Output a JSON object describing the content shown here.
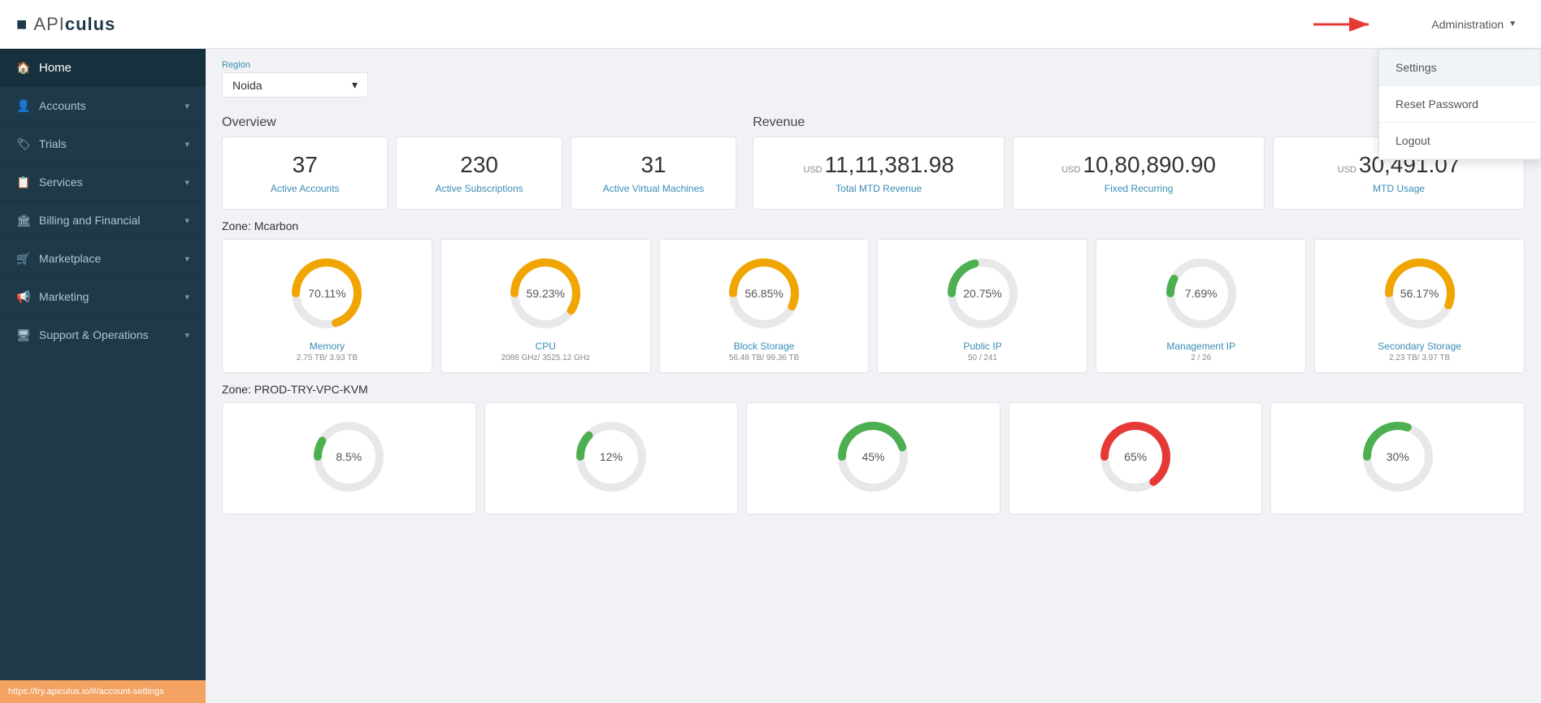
{
  "sidebar": {
    "logo": "APICULUS",
    "home_label": "Home",
    "nav_items": [
      {
        "label": "Accounts",
        "icon": "👤"
      },
      {
        "label": "Trials",
        "icon": "🏷"
      },
      {
        "label": "Services",
        "icon": "📋"
      },
      {
        "label": "Billing and Financial",
        "icon": "🏛"
      },
      {
        "label": "Marketplace",
        "icon": "🛒"
      },
      {
        "label": "Marketing",
        "icon": "📢"
      },
      {
        "label": "Support & Operations",
        "icon": "🖥"
      }
    ],
    "status_url": "https://try.apiculus.io/#/account-settings"
  },
  "header": {
    "admin_label": "Administration",
    "dropdown": {
      "items": [
        {
          "label": "Settings",
          "active": true
        },
        {
          "label": "Reset Password",
          "active": false
        },
        {
          "label": "Logout",
          "active": false
        }
      ]
    }
  },
  "region": {
    "label": "Region",
    "value": "Noida"
  },
  "overview": {
    "title": "Overview",
    "stats": [
      {
        "number": "37",
        "label": "Active Accounts"
      },
      {
        "number": "230",
        "label": "Active Subscriptions"
      },
      {
        "number": "31",
        "label": "Active Virtual Machines"
      }
    ]
  },
  "revenue": {
    "title": "Revenue",
    "stats": [
      {
        "currency": "USD",
        "number": "11,11,381.98",
        "label": "Total MTD Revenue"
      },
      {
        "currency": "USD",
        "number": "10,80,890.90",
        "label": "Fixed Recurring"
      },
      {
        "currency": "USD",
        "number": "30,491.07",
        "label": "MTD Usage"
      }
    ]
  },
  "zone_mcarbon": {
    "title": "Zone: Mcarbon",
    "gauges": [
      {
        "percent": "70.11%",
        "label": "Memory",
        "sublabel": "2.75 TB/ 3.93 TB",
        "color": "#f0a500",
        "bg": "#e8e8e8",
        "value": 70.11
      },
      {
        "percent": "59.23%",
        "label": "CPU",
        "sublabel": "2088 GHz/ 3525.12 GHz",
        "color": "#f0a500",
        "bg": "#e8e8e8",
        "value": 59.23
      },
      {
        "percent": "56.85%",
        "label": "Block Storage",
        "sublabel": "56.48 TB/ 99.36 TB",
        "color": "#f0a500",
        "bg": "#e8e8e8",
        "value": 56.85
      },
      {
        "percent": "20.75%",
        "label": "Public IP",
        "sublabel": "50 / 241",
        "color": "#4caf50",
        "bg": "#e8e8e8",
        "value": 20.75
      },
      {
        "percent": "7.69%",
        "label": "Management IP",
        "sublabel": "2 / 26",
        "color": "#4caf50",
        "bg": "#e8e8e8",
        "value": 7.69
      },
      {
        "percent": "56.17%",
        "label": "Secondary Storage",
        "sublabel": "2.23 TB/ 3.97 TB",
        "color": "#f0a500",
        "bg": "#e8e8e8",
        "value": 56.17
      }
    ]
  },
  "zone_prod": {
    "title": "Zone: PROD-TRY-VPC-KVM",
    "gauges": [
      {
        "percent": "8.5%",
        "label": "",
        "sublabel": "",
        "color": "#4caf50",
        "bg": "#e8e8e8",
        "value": 8.5
      },
      {
        "percent": "12%",
        "label": "",
        "sublabel": "",
        "color": "#4caf50",
        "bg": "#e8e8e8",
        "value": 12
      },
      {
        "percent": "45%",
        "label": "",
        "sublabel": "",
        "color": "#4caf50",
        "bg": "#e8e8e8",
        "value": 45
      },
      {
        "percent": "65%",
        "label": "",
        "sublabel": "",
        "color": "#e53935",
        "bg": "#e8e8e8",
        "value": 65
      },
      {
        "percent": "30%",
        "label": "",
        "sublabel": "",
        "color": "#4caf50",
        "bg": "#e8e8e8",
        "value": 30
      }
    ]
  }
}
